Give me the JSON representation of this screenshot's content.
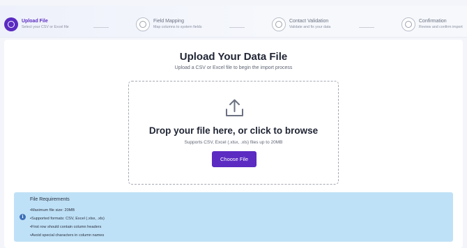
{
  "stepper": {
    "steps": [
      {
        "title": "Upload File",
        "subtitle": "Select your CSV or Excel file",
        "state": "active"
      },
      {
        "title": "Field Mapping",
        "subtitle": "Map columns to system fields",
        "state": "pending"
      },
      {
        "title": "Contact Validation",
        "subtitle": "Validate and fix your data",
        "state": "pending"
      },
      {
        "title": "Confirmation",
        "subtitle": "Review and confirm import",
        "state": "pending"
      }
    ]
  },
  "main": {
    "title": "Upload Your Data File",
    "subtitle": "Upload a CSV or Excel file to begin the import process",
    "dropzone": {
      "icon": "upload-icon",
      "title": "Drop your file here, or click to browse",
      "support_text": "Supports CSV, Excel (.xlsx, .xls) files up to 20MB",
      "button_label": "Choose File"
    }
  },
  "requirements": {
    "icon": "info-icon",
    "title": "File Requirements",
    "items": [
      "Maximum file size: 20MB",
      "Supported formats: CSV, Excel (.xlsx, .xls)",
      "First row should contain column headers",
      "Avoid special characters in column names"
    ]
  },
  "colors": {
    "accent": "#5b2bc2",
    "info_background": "#bfe1f7",
    "info_icon": "#3e6fb8"
  }
}
